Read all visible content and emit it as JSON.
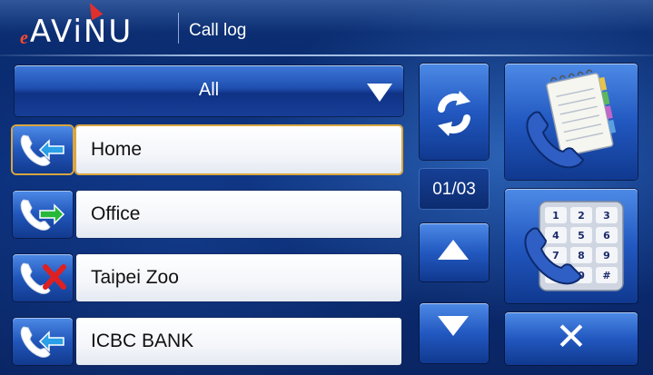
{
  "header": {
    "logo_prefix": "e",
    "logo_text": "AViNU",
    "title": "Call log"
  },
  "filter": {
    "selected": "All"
  },
  "call_log": {
    "items": [
      {
        "name": "Home",
        "type": "incoming",
        "icon": "incoming-call-icon",
        "selected": true
      },
      {
        "name": "Office",
        "type": "outgoing",
        "icon": "outgoing-call-icon",
        "selected": false
      },
      {
        "name": "Taipei Zoo",
        "type": "missed",
        "icon": "missed-call-icon",
        "selected": false
      },
      {
        "name": "ICBC BANK",
        "type": "incoming",
        "icon": "incoming-call-icon",
        "selected": false
      }
    ]
  },
  "pagination": {
    "indicator": "01/03"
  },
  "actions": {
    "refresh_icon": "refresh-icon",
    "phonebook_icon": "phonebook-icon",
    "dialpad_icon": "dialpad-icon",
    "dialpad_keys": [
      "1",
      "2",
      "3",
      "4",
      "5",
      "6",
      "7",
      "8",
      "9",
      "*",
      "0",
      "#"
    ],
    "close_icon": "close-icon"
  },
  "colors": {
    "background": "#0b2f7a",
    "accent": "#2258c0",
    "selection": "#d9a640",
    "incoming_arrow": "#2aa0e8",
    "outgoing_arrow": "#27b83a",
    "missed_x": "#e02020"
  }
}
